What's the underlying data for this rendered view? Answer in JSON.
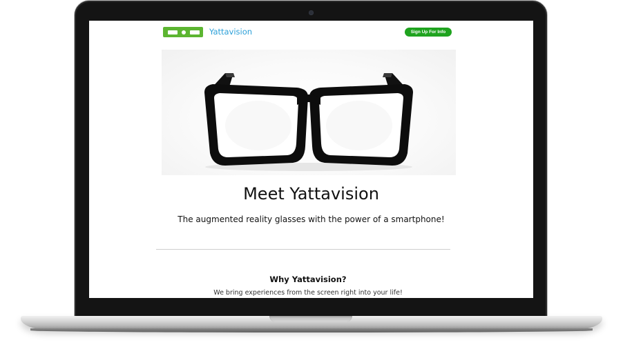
{
  "header": {
    "brand_name": "Yattavision",
    "signup_label": "Sign Up For Info"
  },
  "hero": {
    "image_icon": "eyeglasses-image"
  },
  "main": {
    "headline": "Meet Yattavision",
    "tagline": "The augmented reality glasses with the power of a smartphone!"
  },
  "why_section": {
    "heading": "Why Yattavision?",
    "text": "We bring experiences from the screen right into your life!"
  },
  "colors": {
    "brand_green": "#5cb531",
    "button_green": "#1fa31f",
    "brand_blue": "#2a9fd8"
  }
}
